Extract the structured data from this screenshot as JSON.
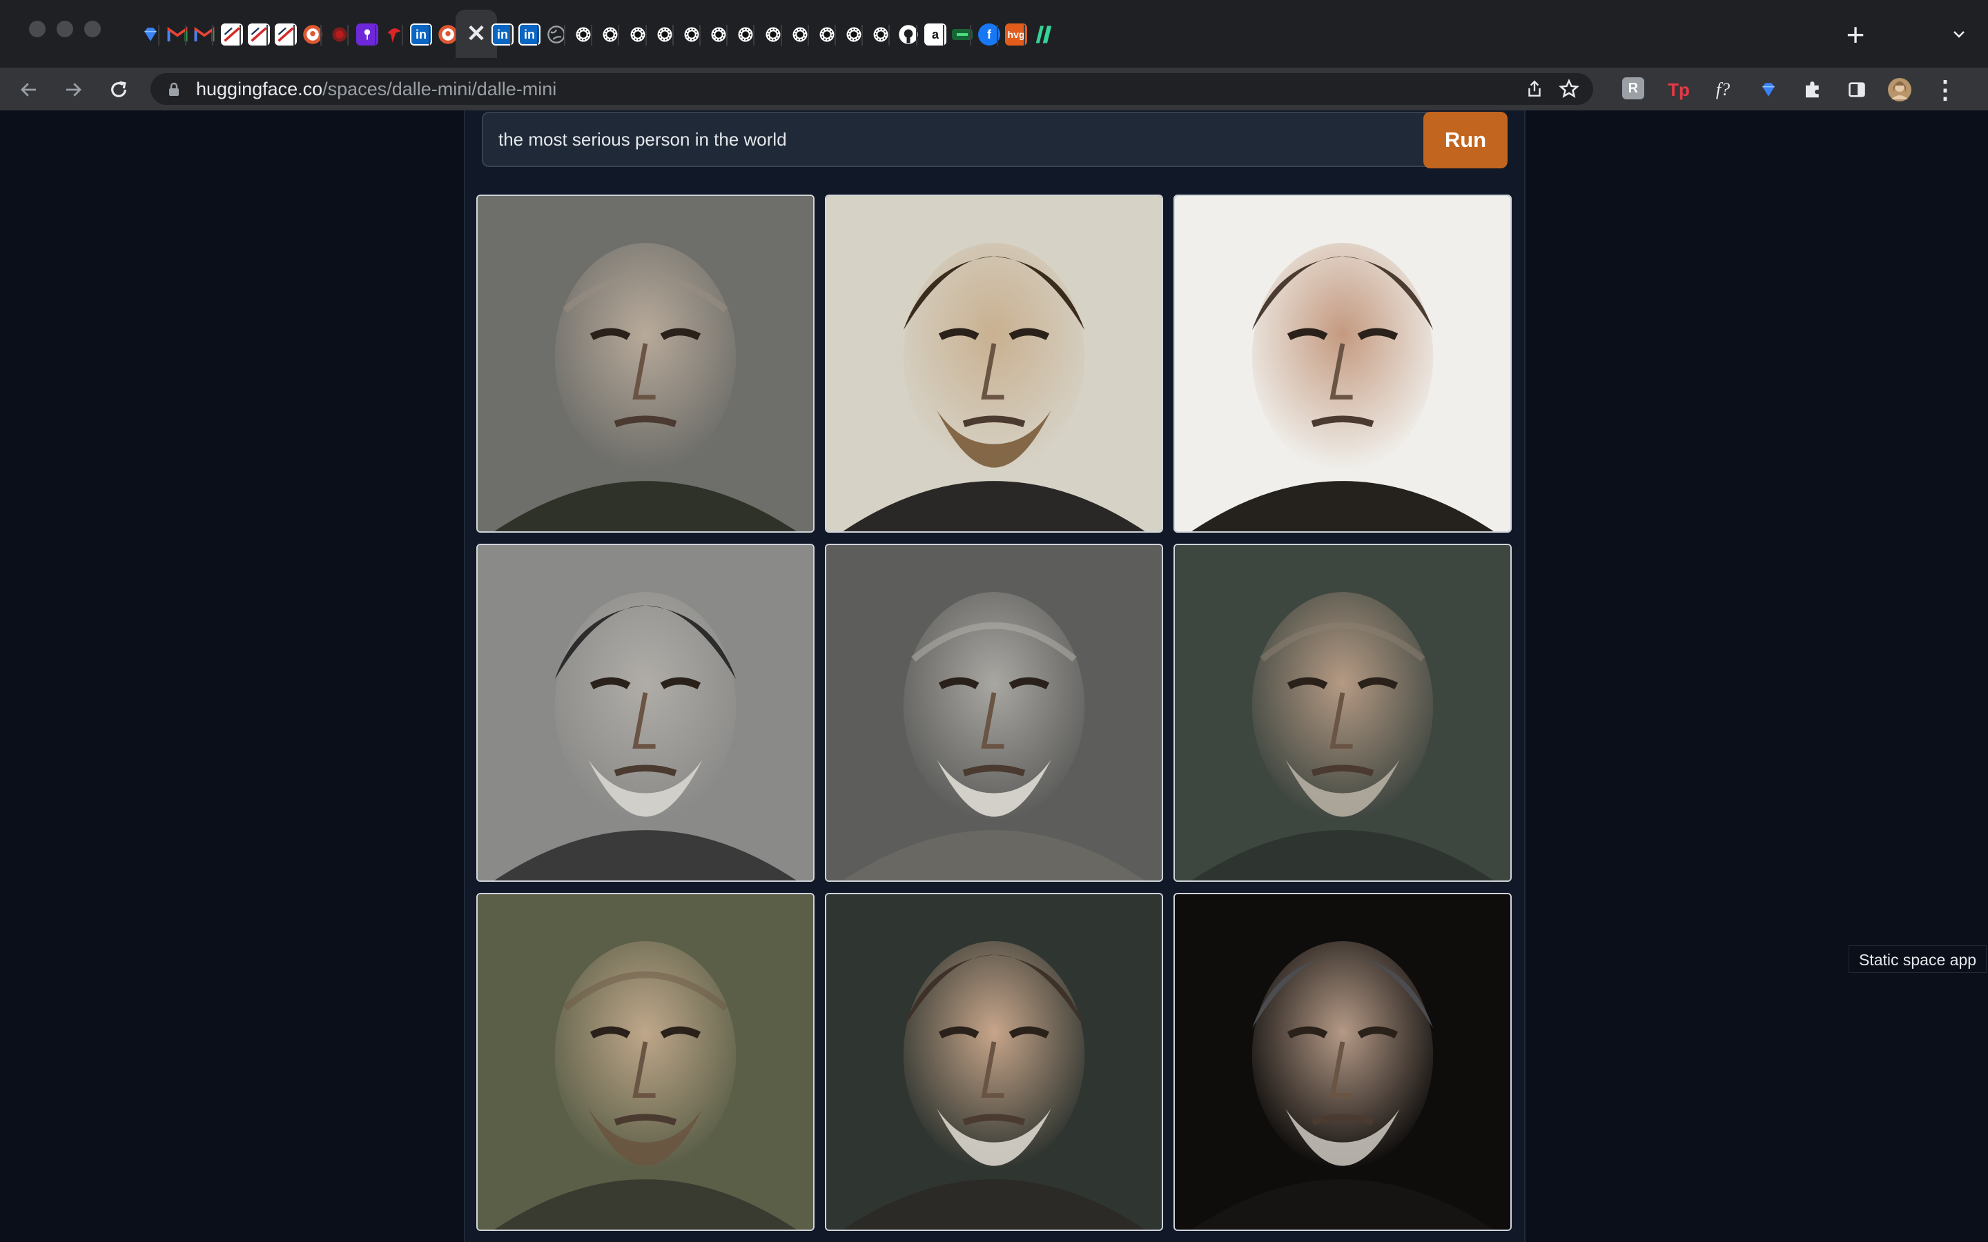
{
  "browser": {
    "url_domain": "huggingface.co",
    "url_path": "/spaces/dalle-mini/dalle-mini",
    "active_tab_close_glyph": "✕",
    "tabs": [
      {
        "icon": "gem-icon",
        "label": "",
        "color": "#3b82f6"
      },
      {
        "icon": "gmail-icon",
        "label": "M",
        "color": "#ea4335"
      },
      {
        "icon": "gmail-icon",
        "label": "M",
        "color": "#ea4335"
      },
      {
        "icon": "slashed-doc-icon",
        "label": "",
        "color": "#ffffff"
      },
      {
        "icon": "slashed-doc-icon",
        "label": "",
        "color": "#ffffff"
      },
      {
        "icon": "slashed-doc-icon",
        "label": "",
        "color": "#ffffff"
      },
      {
        "icon": "duckduckgo-icon",
        "label": "",
        "color": "#de5833"
      },
      {
        "icon": "red-dot-icon",
        "label": "",
        "color": "#7f1d1d"
      },
      {
        "icon": "purple-app-icon",
        "label": "",
        "color": "#6d28d9"
      },
      {
        "icon": "red-app-icon",
        "label": "",
        "color": "#dc2626"
      },
      {
        "icon": "linkedin-icon",
        "label": "in",
        "color": "#0a66c2"
      },
      {
        "icon": "duckduckgo-icon",
        "label": "",
        "color": "#de5833"
      },
      {
        "icon": "close-icon",
        "label": "",
        "color": "#e8eaed"
      },
      {
        "icon": "linkedin-icon",
        "label": "in",
        "color": "#0a66c2"
      },
      {
        "icon": "linkedin-icon",
        "label": "in",
        "color": "#0a66c2"
      },
      {
        "icon": "globe-icon",
        "label": "",
        "color": "#9aa0a6"
      },
      {
        "icon": "gear-icon",
        "label": "",
        "color": "#ffffff"
      },
      {
        "icon": "gear-icon",
        "label": "",
        "color": "#ffffff"
      },
      {
        "icon": "gear-icon",
        "label": "",
        "color": "#ffffff"
      },
      {
        "icon": "gear-icon",
        "label": "",
        "color": "#ffffff"
      },
      {
        "icon": "gear-icon",
        "label": "",
        "color": "#ffffff"
      },
      {
        "icon": "gear-icon",
        "label": "",
        "color": "#ffffff"
      },
      {
        "icon": "gear-icon",
        "label": "",
        "color": "#ffffff"
      },
      {
        "icon": "gear-icon",
        "label": "",
        "color": "#ffffff"
      },
      {
        "icon": "gear-icon",
        "label": "",
        "color": "#ffffff"
      },
      {
        "icon": "gear-icon",
        "label": "",
        "color": "#ffffff"
      },
      {
        "icon": "gear-icon",
        "label": "",
        "color": "#ffffff"
      },
      {
        "icon": "gear-icon",
        "label": "",
        "color": "#ffffff"
      },
      {
        "icon": "github-icon",
        "label": "",
        "color": "#ffffff"
      },
      {
        "icon": "amazon-icon",
        "label": "a",
        "color": "#ffffff"
      },
      {
        "icon": "green-app-icon",
        "label": "",
        "color": "#16a34a"
      },
      {
        "icon": "facebook-icon",
        "label": "f",
        "color": "#1877f2"
      },
      {
        "icon": "hvg-icon",
        "label": "hvg",
        "color": "#e25d1b"
      },
      {
        "icon": "green-stripes-icon",
        "label": "",
        "color": "#34d399"
      }
    ],
    "extensions": [
      {
        "icon": "r-extension-icon",
        "label": "R"
      },
      {
        "icon": "tp-extension-icon",
        "label": "Tp"
      },
      {
        "icon": "formula-extension-icon",
        "label": "f?"
      },
      {
        "icon": "gem-extension-icon",
        "label": ""
      },
      {
        "icon": "puzzle-icon",
        "label": ""
      },
      {
        "icon": "sidepanel-icon",
        "label": ""
      },
      {
        "icon": "profile-avatar",
        "label": ""
      },
      {
        "icon": "kebab-menu-icon",
        "label": "⋮"
      }
    ]
  },
  "app": {
    "prompt_value": "the most serious person in the world",
    "run_label": "Run",
    "results": [
      {
        "name": "result-image-1"
      },
      {
        "name": "result-image-2"
      },
      {
        "name": "result-image-3"
      },
      {
        "name": "result-image-4"
      },
      {
        "name": "result-image-5"
      },
      {
        "name": "result-image-6"
      },
      {
        "name": "result-image-7"
      },
      {
        "name": "result-image-8"
      },
      {
        "name": "result-image-9"
      }
    ]
  },
  "tooltip": "Static space app",
  "colors": {
    "accent": "#c2651f",
    "page_bg": "#0b0f19",
    "panel_bg": "#111827"
  }
}
